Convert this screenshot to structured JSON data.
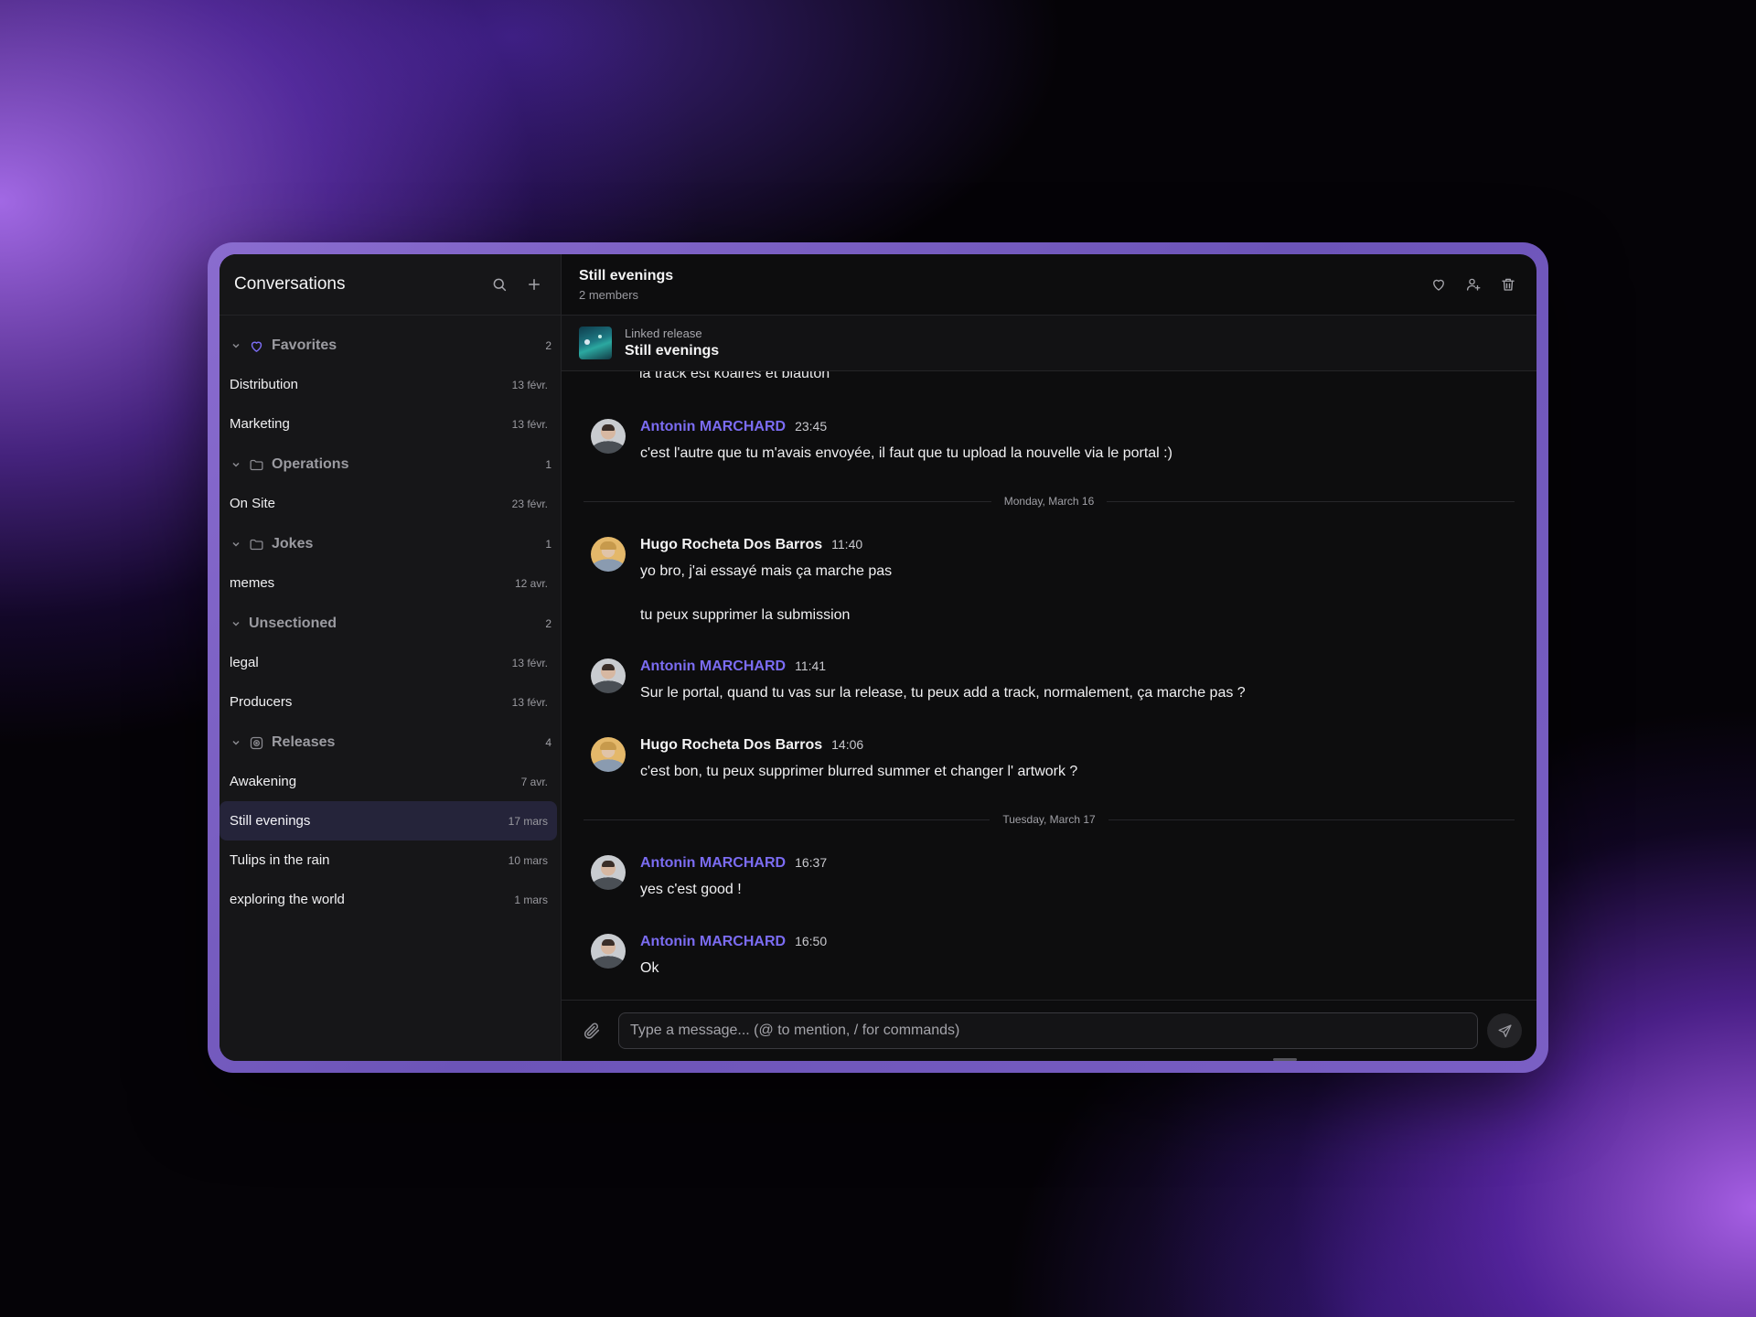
{
  "sidebar": {
    "title": "Conversations",
    "sections": [
      {
        "label": "Favorites",
        "count": "2",
        "icon": "heart-icon",
        "items": [
          {
            "label": "Distribution",
            "date": "13 févr."
          },
          {
            "label": "Marketing",
            "date": "13 févr."
          }
        ]
      },
      {
        "label": "Operations",
        "count": "1",
        "icon": "folder-icon",
        "items": [
          {
            "label": "On Site",
            "date": "23 févr."
          }
        ]
      },
      {
        "label": "Jokes",
        "count": "1",
        "icon": "folder-icon",
        "items": [
          {
            "label": "memes",
            "date": "12 avr."
          }
        ]
      },
      {
        "label": "Unsectioned",
        "count": "2",
        "icon": "",
        "items": [
          {
            "label": "legal",
            "date": "13 févr."
          },
          {
            "label": "Producers",
            "date": "13 févr."
          }
        ]
      },
      {
        "label": "Releases",
        "count": "4",
        "icon": "disc-icon",
        "items": [
          {
            "label": "Awakening",
            "date": "7 avr."
          },
          {
            "label": "Still evenings",
            "date": "17 mars"
          },
          {
            "label": "Tulips in the rain",
            "date": "10 mars"
          },
          {
            "label": "exploring the world",
            "date": "1 mars"
          }
        ]
      }
    ]
  },
  "header": {
    "title": "Still evenings",
    "subtitle": "2 members"
  },
  "linked": {
    "label": "Linked release",
    "title": "Still evenings"
  },
  "messages": {
    "partial": "la track est koalres et blauton",
    "m1": {
      "author": "Antonin MARCHARD",
      "time": "23:45",
      "text": "c'est l'autre que tu m'avais envoyée, il faut que tu upload la nouvelle via le portal :)"
    },
    "d1": "Monday, March 16",
    "m2": {
      "author": "Hugo Rocheta Dos Barros",
      "time": "11:40",
      "text1": "yo bro, j'ai essayé mais ça marche pas",
      "text2": "tu peux supprimer la submission"
    },
    "m3": {
      "author": "Antonin MARCHARD",
      "time": "11:41",
      "text": "Sur le portal, quand tu vas sur la release, tu peux add a track, normalement, ça marche pas ?"
    },
    "m4": {
      "author": "Hugo Rocheta Dos Barros",
      "time": "14:06",
      "text": "c'est bon, tu peux supprimer blurred summer et changer l' artwork ?"
    },
    "d2": "Tuesday, March 17",
    "m5": {
      "author": "Antonin MARCHARD",
      "time": "16:37",
      "text": "yes c'est good !"
    },
    "m6": {
      "author": "Antonin MARCHARD",
      "time": "16:50",
      "text": "Ok"
    }
  },
  "composer": {
    "placeholder": "Type a message... (@ to mention, / for commands)"
  },
  "colors": {
    "accent": "#7b6cf2",
    "active_item": "#25243a"
  }
}
